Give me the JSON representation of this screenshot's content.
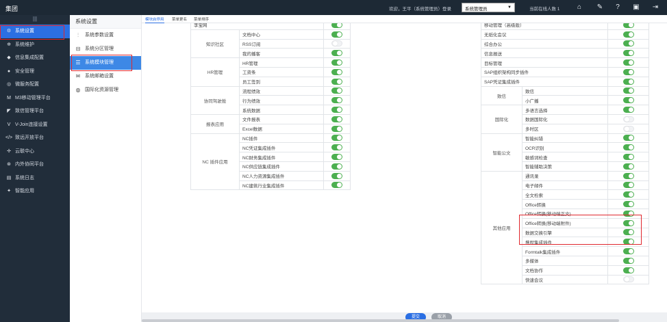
{
  "app": {
    "brand": "集团"
  },
  "topbar": {
    "welcome": "欢迎，王平（系统管理员）登录",
    "role": "系统管理员",
    "online": "当前在线人数 1",
    "icons": [
      "home-icon",
      "wrench-icon",
      "help-icon",
      "save-icon",
      "logout-icon"
    ]
  },
  "leftnav": {
    "collapse": "|||",
    "items": [
      {
        "label": "系统设置",
        "icon": "gear-icon"
      },
      {
        "label": "系统维护",
        "icon": "maintenance-icon"
      },
      {
        "label": "信息集成配置",
        "icon": "integration-icon"
      },
      {
        "label": "安全管理",
        "icon": "shield-icon"
      },
      {
        "label": "微服务配置",
        "icon": "microservice-icon"
      },
      {
        "label": "M3移动管理平台",
        "icon": "m3-icon"
      },
      {
        "label": "致信管理平台",
        "icon": "message-icon"
      },
      {
        "label": "V-Join连接设置",
        "icon": "vjoin-icon"
      },
      {
        "label": "致远开放平台",
        "icon": "code-icon"
      },
      {
        "label": "云联中心",
        "icon": "cloud-icon"
      },
      {
        "label": "内外协同平台",
        "icon": "collab-icon"
      },
      {
        "label": "系统日志",
        "icon": "log-icon"
      },
      {
        "label": "智能应用",
        "icon": "smart-icon"
      }
    ]
  },
  "subnav": {
    "title": "系统设置",
    "items": [
      {
        "label": "系统参数设置",
        "icon": "sliders-icon"
      },
      {
        "label": "系统分区管理",
        "icon": "partition-icon"
      },
      {
        "label": "系统模块管理",
        "icon": "list-icon"
      },
      {
        "label": "系统邮箱设置",
        "icon": "mail-icon"
      },
      {
        "label": "国际化资源管理",
        "icon": "globe-icon"
      }
    ]
  },
  "tabs": [
    "模块启停用",
    "菜单更名",
    "菜单排序"
  ],
  "left_table": [
    {
      "category": "",
      "items": [
        {
          "label": "李宝网",
          "on": true
        }
      ]
    },
    {
      "category": "知识社区",
      "items": [
        {
          "label": "文档中心",
          "on": true
        },
        {
          "label": "RSS订阅",
          "on": false
        },
        {
          "label": "我的播客",
          "on": true
        }
      ]
    },
    {
      "category": "HR管理",
      "items": [
        {
          "label": "HR管理",
          "on": true
        },
        {
          "label": "工资条",
          "on": true
        },
        {
          "label": "员工签到",
          "on": true
        }
      ]
    },
    {
      "category": "协同驾驶舱",
      "items": [
        {
          "label": "流程绩效",
          "on": true
        },
        {
          "label": "行为绩效",
          "on": true
        },
        {
          "label": "系统数据",
          "on": true
        }
      ]
    },
    {
      "category": "报表应用",
      "items": [
        {
          "label": "文件报表",
          "on": true
        },
        {
          "label": "Excel数据",
          "on": true
        }
      ]
    },
    {
      "category": "NC 插件应用",
      "items": [
        {
          "label": "NC插件",
          "on": true
        },
        {
          "label": "NC凭证集成插件",
          "on": true
        },
        {
          "label": "NC财务集成插件",
          "on": true
        },
        {
          "label": "NC供应链集成插件",
          "on": true
        },
        {
          "label": "NC人力资源集成插件",
          "on": true
        },
        {
          "label": "NC建筑行业集成插件",
          "on": true
        }
      ]
    }
  ],
  "right_table": [
    {
      "category": "",
      "items": [
        {
          "label": "移动管理（高级版）",
          "on": true
        },
        {
          "label": "无纸化会议",
          "on": true
        },
        {
          "label": "综合办公",
          "on": true
        },
        {
          "label": "信息报送",
          "on": true
        },
        {
          "label": "目标管理",
          "on": true
        },
        {
          "label": "SAP组织架构同步插件",
          "on": true
        },
        {
          "label": "SAP凭证集成插件",
          "on": true
        }
      ]
    },
    {
      "category": "致信",
      "items": [
        {
          "label": "致信",
          "on": true
        },
        {
          "label": "小广播",
          "on": true
        }
      ]
    },
    {
      "category": "国际化",
      "items": [
        {
          "label": "多语言选择",
          "on": true
        },
        {
          "label": "数据国际化",
          "on": false
        },
        {
          "label": "多时区",
          "on": false
        }
      ]
    },
    {
      "category": "智能公文",
      "items": [
        {
          "label": "智能纠错",
          "on": true
        },
        {
          "label": "OCR识别",
          "on": true
        },
        {
          "label": "敏感词检查",
          "on": true
        },
        {
          "label": "智能辅助决策",
          "on": true
        }
      ]
    },
    {
      "category": "其他应用",
      "items": [
        {
          "label": "通讯录",
          "on": true
        },
        {
          "label": "电子邮件",
          "on": true
        },
        {
          "label": "全文检索",
          "on": true
        },
        {
          "label": "Office转换",
          "on": true
        },
        {
          "label": "Office转换(移动端正文)",
          "on": true
        },
        {
          "label": "Office转换(移动端附件)",
          "on": true
        },
        {
          "label": "数据交换引擎",
          "on": true
        },
        {
          "label": "携程集成插件",
          "on": true
        },
        {
          "label": "Formtalk集成插件",
          "on": true
        },
        {
          "label": "多媒体",
          "on": true
        },
        {
          "label": "文档协作",
          "on": true
        },
        {
          "label": "快速会议",
          "on": false
        }
      ]
    }
  ],
  "footer": {
    "submit": "提交",
    "cancel": "取消"
  },
  "colors": {
    "accent": "#2b6fe3",
    "toggle_on": "#4caf50",
    "highlight": "#e0262c",
    "nav_bg": "#212d3a"
  }
}
